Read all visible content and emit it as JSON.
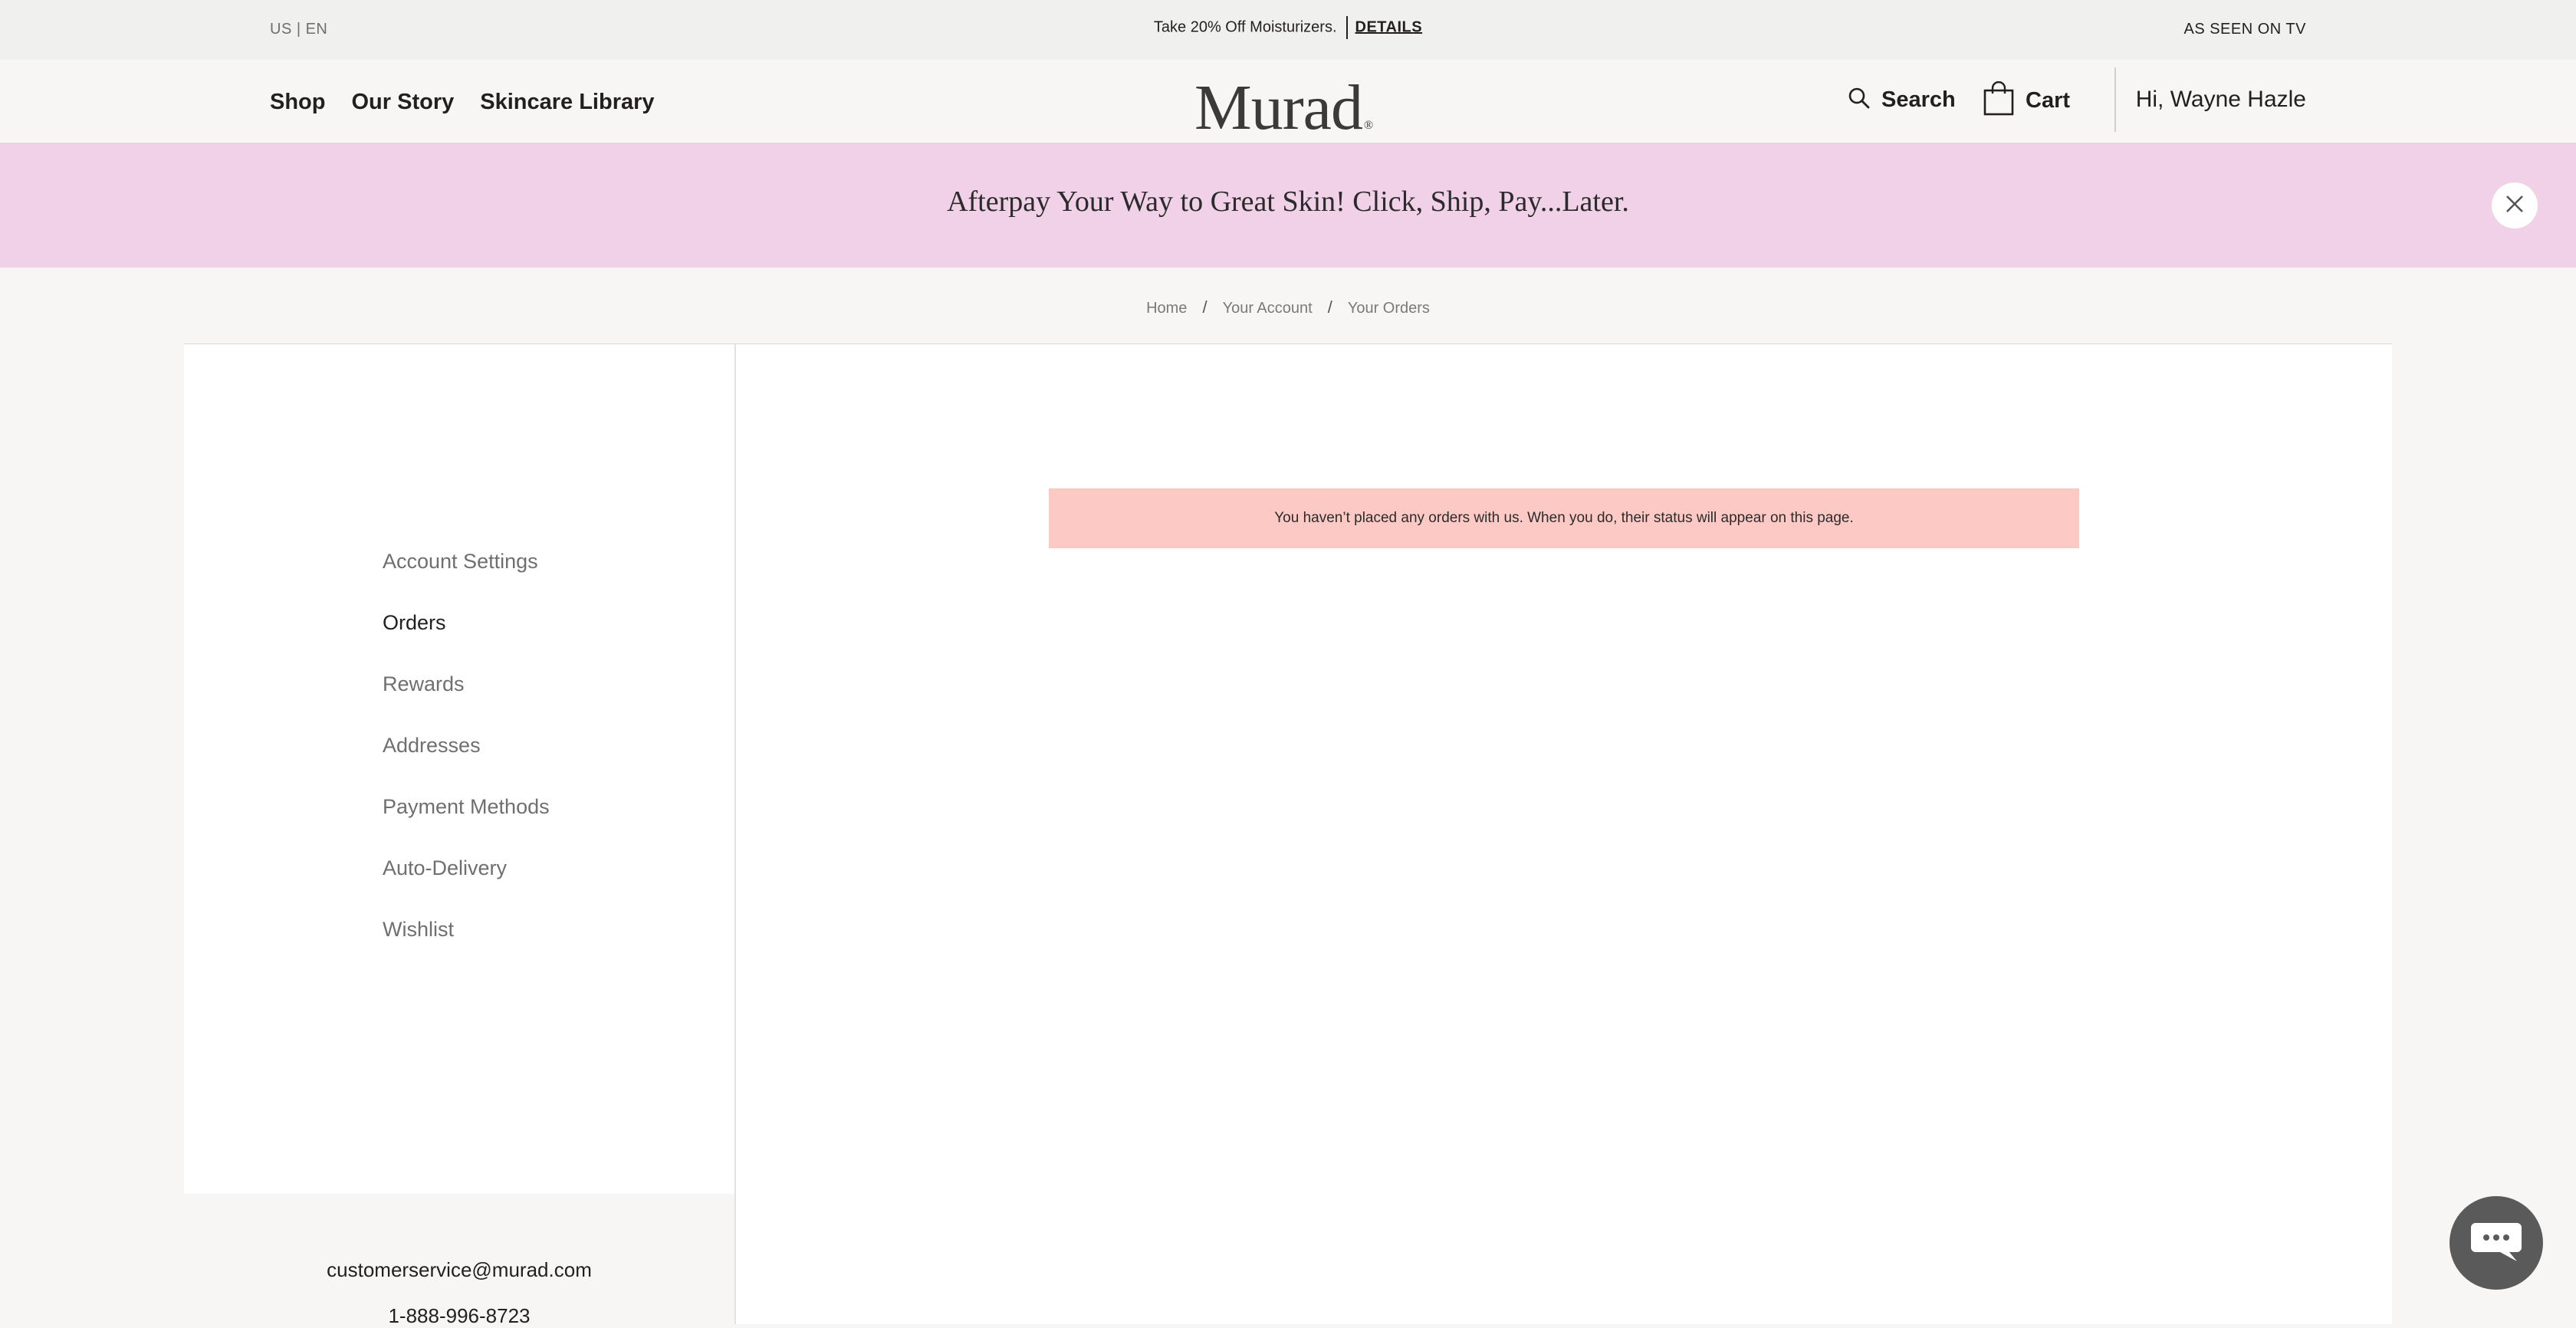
{
  "utility": {
    "locale": "US | EN",
    "promo_text": "Take 20% Off Moisturizers.",
    "promo_link": "DETAILS",
    "tv_link": "AS SEEN ON TV"
  },
  "header": {
    "nav": [
      "Shop",
      "Our Story",
      "Skincare Library"
    ],
    "logo": "Murad",
    "search_label": "Search",
    "cart_label": "Cart",
    "greeting": "Hi, Wayne Hazle"
  },
  "banner": {
    "text": "Afterpay Your Way to Great Skin! Click, Ship, Pay...Later."
  },
  "breadcrumb": [
    "Home",
    "Your Account",
    "Your Orders"
  ],
  "sidebar": {
    "items": [
      {
        "label": "Account Settings",
        "active": false
      },
      {
        "label": "Orders",
        "active": true
      },
      {
        "label": "Rewards",
        "active": false
      },
      {
        "label": "Addresses",
        "active": false
      },
      {
        "label": "Payment Methods",
        "active": false
      },
      {
        "label": "Auto-Delivery",
        "active": false
      },
      {
        "label": "Wishlist",
        "active": false
      }
    ],
    "email": "customerservice@murad.com",
    "phone": "1-888-996-8723"
  },
  "main": {
    "empty_message": "You haven’t placed any orders with us. When you do, their status will appear on this page."
  },
  "colors": {
    "banner_bg": "#f1d1e8",
    "alert_bg": "#fdc9c5",
    "chat_bg": "#5a5a5a"
  },
  "icons": {
    "search": "search-icon",
    "cart": "shopping-bag-icon",
    "close": "close-icon",
    "chat": "chat-icon"
  }
}
